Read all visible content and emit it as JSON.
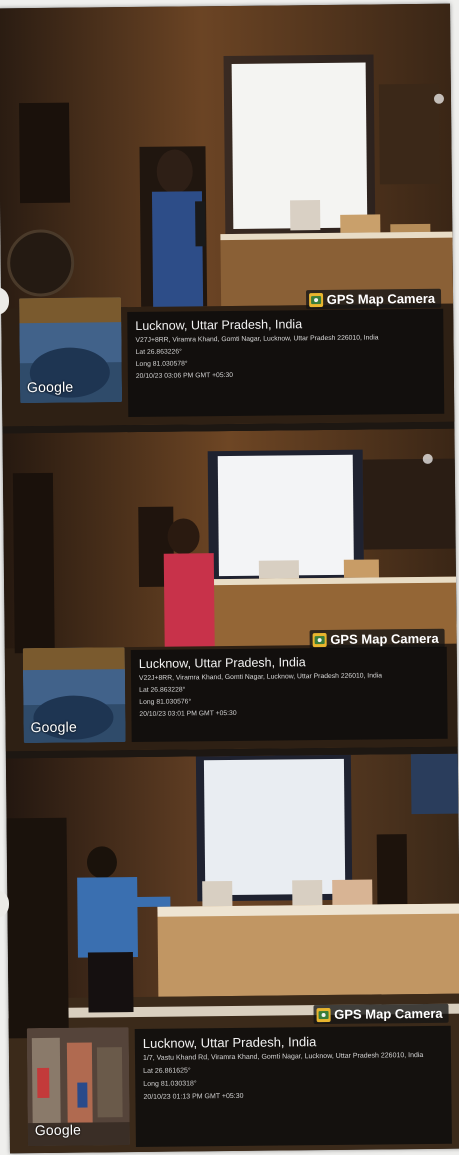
{
  "photos": [
    {
      "badge": "GPS Map Camera",
      "map_label": "Google",
      "location": "Lucknow, Uttar Pradesh, India",
      "address": "V27J+8RR, Viramra Khand, Gomti Nagar, Lucknow, Uttar Pradesh 226010, India",
      "lat": "Lat 26.863226°",
      "long": "Long 81.030578°",
      "datetime": "20/10/23 03:06 PM GMT +05:30"
    },
    {
      "badge": "GPS Map Camera",
      "map_label": "Google",
      "location": "Lucknow, Uttar Pradesh, India",
      "address": "V22J+8RR, Viramra Khand, Gomti Nagar, Lucknow, Uttar Pradesh 226010, India",
      "lat": "Lat 26.863228°",
      "long": "Long 81.030576°",
      "datetime": "20/10/23 03:01 PM GMT +05:30"
    },
    {
      "badge": "GPS Map Camera",
      "map_label": "Google",
      "location": "Lucknow, Uttar Pradesh, India",
      "address": "1/7, Vastu Khand Rd, Viramra Khand, Gomti Nagar, Lucknow, Uttar Pradesh 226010, India",
      "lat": "Lat 26.861625°",
      "long": "Long 81.030318°",
      "datetime": "20/10/23 01:13 PM GMT +05:30"
    }
  ],
  "colors": {
    "wall": "#5c3a1f",
    "screen": "#f4f4f2",
    "overlay": "#141414",
    "badge_icon": "#e9b52e"
  }
}
